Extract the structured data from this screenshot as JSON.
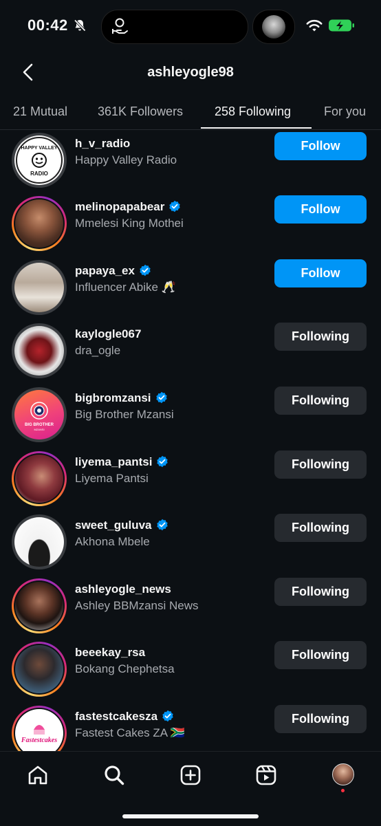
{
  "status_bar": {
    "time": "00:42"
  },
  "header": {
    "title": "ashleyogle98"
  },
  "tabs": [
    {
      "label": "21 Mutual"
    },
    {
      "label": "361K Followers"
    },
    {
      "label": "258 Following",
      "active": true
    },
    {
      "label": "For you"
    }
  ],
  "accounts": [
    {
      "username": "h_v_radio",
      "name": "Happy Valley Radio",
      "verified": false,
      "button": "Follow",
      "ring": false
    },
    {
      "username": "melinopapabear",
      "name": "Mmelesi King Mothei",
      "verified": true,
      "button": "Follow",
      "ring": true
    },
    {
      "username": "papaya_ex",
      "name": "Influencer Abike 🥂",
      "verified": true,
      "button": "Follow",
      "ring": false
    },
    {
      "username": "kaylogle067",
      "name": "dra_ogle",
      "verified": false,
      "button": "Following",
      "ring": false
    },
    {
      "username": "bigbromzansi",
      "name": "Big Brother Mzansi",
      "verified": true,
      "button": "Following",
      "ring": false
    },
    {
      "username": "liyema_pantsi",
      "name": "Liyema Pantsi",
      "verified": true,
      "button": "Following",
      "ring": true
    },
    {
      "username": "sweet_guluva",
      "name": "Akhona Mbele",
      "verified": true,
      "button": "Following",
      "ring": false
    },
    {
      "username": "ashleyogle_news",
      "name": "Ashley BBMzansi News",
      "verified": false,
      "button": "Following",
      "ring": true
    },
    {
      "username": "beeekay_rsa",
      "name": "Bokang Chephetsa",
      "verified": false,
      "button": "Following",
      "ring": true
    },
    {
      "username": "fastestcakesza",
      "name": "Fastest Cakes ZA 🇿🇦",
      "verified": true,
      "button": "Following",
      "ring": true
    }
  ],
  "avatar_labels": {
    "radio_top": "HAPPY VALLEY",
    "radio_bottom": "RADIO",
    "bbm_line1": "BIG BROTHER",
    "bbm_line2": "MZANSI",
    "cakes": "Fastestcakes"
  },
  "tabbar": {
    "icons": [
      "home-icon",
      "search-icon",
      "create-icon",
      "reels-icon",
      "profile-avatar"
    ]
  },
  "colors": {
    "background": "#0c1014",
    "follow_button": "#0095f6",
    "following_button": "#262a2f",
    "verified_badge": "#0095f6"
  }
}
